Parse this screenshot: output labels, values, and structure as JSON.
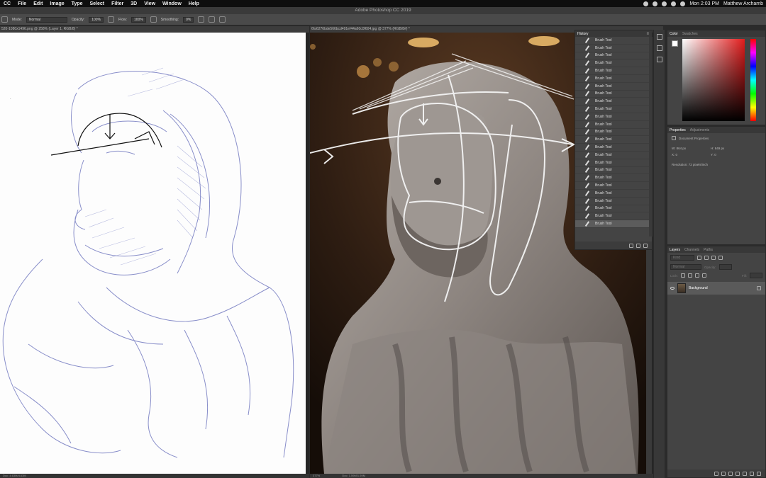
{
  "menubar": {
    "app": "CC",
    "items": [
      "File",
      "Edit",
      "Image",
      "Type",
      "Select",
      "Filter",
      "3D",
      "View",
      "Window",
      "Help"
    ],
    "clock": "Mon 2:03 PM",
    "user": "Matthew Archamb"
  },
  "window": {
    "title": "Adobe Photoshop CC 2019"
  },
  "options": {
    "mode_label": "Mode:",
    "mode_value": "Normal",
    "opacity_label": "Opacity:",
    "opacity_value": "100%",
    "flow_label": "Flow:",
    "flow_value": "100%",
    "smoothing_label": "Smoothing:",
    "smoothing_value": "0%"
  },
  "docs": {
    "left_tab": "520-1080x1496.png @ 258% (Layer 1, RGB/8) *",
    "right_tab": "6fa6276bde566bcd491ef44a60c0f604.jpg @ 377% (RGB/8#) *",
    "left_status": "Doc: 4.63M/4.63M",
    "right_status_zoom": "377%",
    "right_status": "Doc: 1.59M/1.59M"
  },
  "history": {
    "title": "History",
    "items": [
      "Brush Tool",
      "Brush Tool",
      "Brush Tool",
      "Brush Tool",
      "Brush Tool",
      "Brush Tool",
      "Brush Tool",
      "Brush Tool",
      "Brush Tool",
      "Brush Tool",
      "Brush Tool",
      "Brush Tool",
      "Brush Tool",
      "Brush Tool",
      "Brush Tool",
      "Brush Tool",
      "Brush Tool",
      "Brush Tool",
      "Brush Tool",
      "Brush Tool",
      "Brush Tool",
      "Brush Tool",
      "Brush Tool",
      "Brush Tool",
      "Brush Tool"
    ]
  },
  "color_panel": {
    "tab1": "Color",
    "tab2": "Swatches"
  },
  "properties": {
    "tab1": "Properties",
    "tab2": "Adjustments",
    "doc_label": "Document Properties",
    "w": "W: 864 px",
    "h": "H: 849 px",
    "x": "X: 0",
    "y": "Y: 0",
    "resolution": "Resolution: 72 pixels/inch"
  },
  "layers": {
    "tab1": "Layers",
    "tab2": "Channels",
    "tab3": "Paths",
    "kind": "Kind",
    "blend": "Normal",
    "opacity_label": "Opacity:",
    "lock_label": "Lock:",
    "fill_label": "Fill:",
    "layer_name": "Background"
  }
}
